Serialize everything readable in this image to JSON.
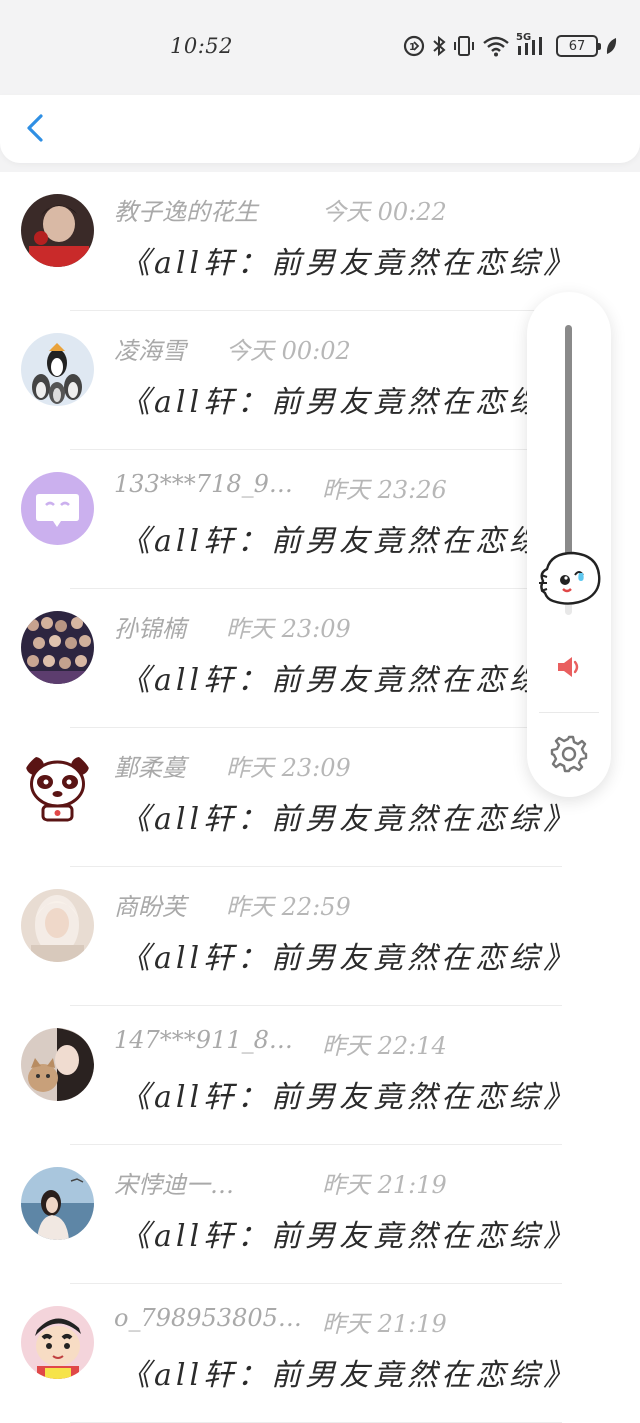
{
  "status_bar": {
    "time": "10:52",
    "network": "5G",
    "battery": "67"
  },
  "conversations": [
    {
      "name": "教子逸的花生",
      "time": "今天 00:22",
      "message": "《all轩：前男友竟然在恋综》",
      "avatar": "photo-red",
      "avatar_color": "#5a3a35"
    },
    {
      "name": "凌海雪",
      "time": "今天 00:02",
      "message": "《all轩：前男友竟然在恋综》",
      "avatar": "penguins",
      "avatar_color": "#dbe7f3"
    },
    {
      "name": "133***718_9…",
      "time": "昨天 23:26",
      "message": "《all轩：前男友竟然在恋综》",
      "avatar": "chat-bubble",
      "avatar_color": "#cdb3ef"
    },
    {
      "name": "孙锦楠",
      "time": "昨天 23:09",
      "message": "《all轩：前男友竟然在恋综》",
      "avatar": "group-photo",
      "avatar_color": "#3a3048"
    },
    {
      "name": "鄞柔蔓",
      "time": "昨天 23:09",
      "message": "《all轩：前男友竟然在恋综》",
      "avatar": "panda",
      "avatar_color": "#ffffff"
    },
    {
      "name": "商盼芙",
      "time": "昨天 22:59",
      "message": "《all轩：前男友竟然在恋综》",
      "avatar": "photo-light",
      "avatar_color": "#e3d6cd"
    },
    {
      "name": "147***911_8…",
      "time": "昨天 22:14",
      "message": "《all轩：前男友竟然在恋综》",
      "avatar": "girl-cat",
      "avatar_color": "#9b8174"
    },
    {
      "name": "宋悖迪一…",
      "time": "昨天 21:19",
      "message": "《all轩：前男友竟然在恋综》",
      "avatar": "sea-photo",
      "avatar_color": "#8fb3d0"
    },
    {
      "name": "o_798953805…",
      "time": "昨天 21:19",
      "message": "《all轩：前男友竟然在恋综》",
      "avatar": "cartoon-boy",
      "avatar_color": "#f3d6dc"
    }
  ],
  "volume": {
    "level": 0.9,
    "accent": "#e95f5f"
  }
}
